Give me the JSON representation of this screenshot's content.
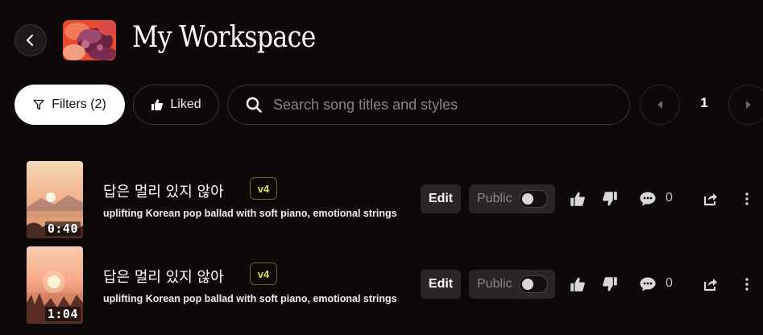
{
  "header": {
    "title": "My Workspace"
  },
  "toolbar": {
    "filters_label": "Filters (2)",
    "liked_label": "Liked",
    "search_placeholder": "Search song titles and styles",
    "search_value": "",
    "page_number": "1"
  },
  "songs": [
    {
      "title": "답은 멀리 있지 않아",
      "version": "v4",
      "style": "uplifting Korean pop ballad with soft piano, emotional strings",
      "duration": "0:40",
      "edit_label": "Edit",
      "visibility_label": "Public",
      "public": false,
      "comment_count": "0"
    },
    {
      "title": "답은 멀리 있지 않아",
      "version": "v4",
      "style": "uplifting Korean pop ballad with soft piano, emotional strings",
      "duration": "1:04",
      "edit_label": "Edit",
      "visibility_label": "Public",
      "public": false,
      "comment_count": "0"
    }
  ],
  "colors": {
    "background": "#0e0909",
    "badge_text": "#d5e94a",
    "badge_border": "#5e6a1c",
    "button_bg": "#2b2626"
  },
  "icons": [
    "chevron-left-icon",
    "filter-icon",
    "thumbs-up-icon",
    "search-icon",
    "caret-left-icon",
    "caret-right-icon",
    "thumbs-down-icon",
    "comment-icon",
    "share-icon",
    "more-vertical-icon"
  ]
}
